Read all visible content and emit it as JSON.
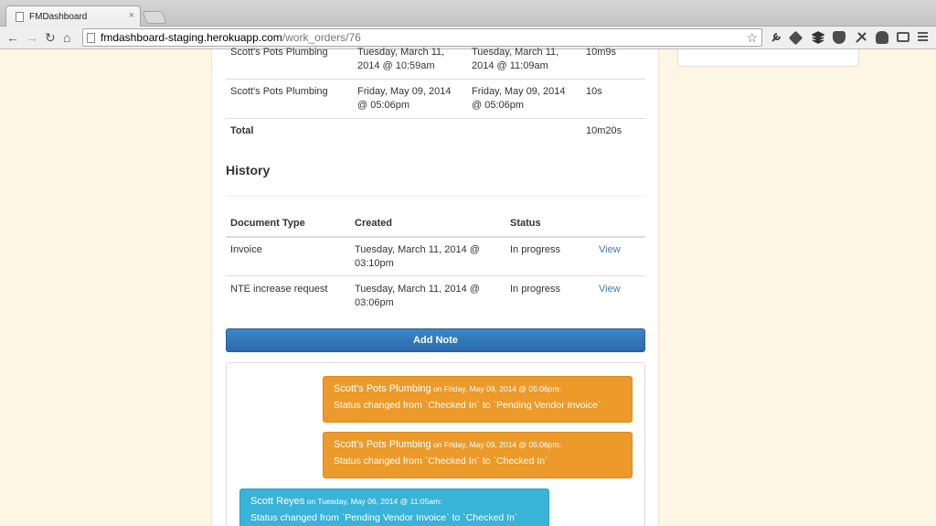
{
  "browser": {
    "tab_title": "FMDashboard",
    "tab_close": "×",
    "url_host": "fmdashboard-staging.herokuapp.com",
    "url_path": "/work_orders/76"
  },
  "time_log": {
    "rows": [
      {
        "vendor": "Scott's Pots Plumbing",
        "start_l1": "Tuesday, March 11,",
        "start_l2": "2014 @ 10:59am",
        "end_l1": "Tuesday, March 11,",
        "end_l2": "2014 @ 11:09am",
        "duration": "10m9s"
      },
      {
        "vendor": "Scott's Pots Plumbing",
        "start_l1": "Friday, May 09, 2014",
        "start_l2": "@ 05:06pm",
        "end_l1": "Friday, May 09, 2014",
        "end_l2": "@ 05:06pm",
        "duration": "10s"
      }
    ],
    "total_label": "Total",
    "total_value": "10m20s"
  },
  "history": {
    "title": "History",
    "headers": {
      "doc_type": "Document Type",
      "created": "Created",
      "status": "Status"
    },
    "rows": [
      {
        "doc_type": "Invoice",
        "created_l1": "Tuesday, March 11, 2014 @",
        "created_l2": "03:10pm",
        "status": "In progress",
        "action": "View"
      },
      {
        "doc_type": "NTE increase request",
        "created_l1": "Tuesday, March 11, 2014 @",
        "created_l2": "03:06pm",
        "status": "In progress",
        "action": "View"
      }
    ]
  },
  "add_note_label": "Add Note",
  "notes": [
    {
      "author": "Scott's Pots Plumbing",
      "date": " on Friday, May 09, 2014 @ 05:06pm:",
      "body": "Status changed from `Checked In` to `Pending Vendor Invoice`",
      "color": "orange"
    },
    {
      "author": "Scott's Pots Plumbing",
      "date": " on Friday, May 09, 2014 @ 05:06pm:",
      "body": "Status changed from `Checked In` to `Checked In`",
      "color": "orange"
    },
    {
      "author": "Scott Reyes",
      "date": " on Tuesday, May 06, 2014 @ 11:05am:",
      "body": "Status changed from `Pending Vendor Invoice` to `Checked In`",
      "color": "blue"
    }
  ],
  "colors": {
    "orange_note": "#ec9a2a",
    "blue_note": "#39b3d7",
    "primary_button": "#2f77b9",
    "page_bg": "#fdf6e3"
  }
}
